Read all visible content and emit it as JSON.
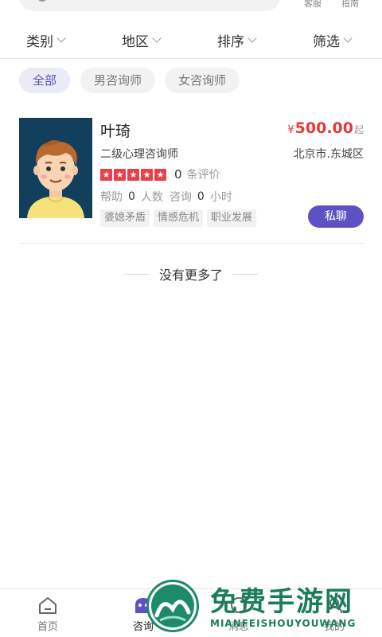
{
  "top": {
    "kefu_label": "客服",
    "guide_label": "指南"
  },
  "filters": [
    {
      "label": "类别"
    },
    {
      "label": "地区"
    },
    {
      "label": "排序"
    },
    {
      "label": "筛选"
    }
  ],
  "chips": [
    {
      "label": "全部",
      "active": true
    },
    {
      "label": "男咨询师",
      "active": false
    },
    {
      "label": "女咨询师",
      "active": false
    }
  ],
  "counselor": {
    "name": "叶琦",
    "currency": "¥",
    "price": "500.00",
    "price_suffix": "起",
    "title": "二级心理咨询师",
    "location": "北京市.东城区",
    "rating_stars": 5,
    "review_count": "0",
    "review_label": "条评价",
    "help_label": "帮助",
    "help_count": "0",
    "help_unit": "人数",
    "consult_label": "咨询",
    "consult_count": "0",
    "consult_unit": "小时",
    "tags": [
      "婆媳矛盾",
      "情感危机",
      "职业发展"
    ],
    "chat_label": "私聊"
  },
  "list_end_text": "没有更多了",
  "tabs": [
    {
      "label": "首页",
      "icon": "home-icon",
      "active": false
    },
    {
      "label": "咨询",
      "icon": "consult-icon",
      "active": true
    },
    {
      "label": "消息",
      "icon": "message-icon",
      "active": false
    },
    {
      "label": "我的",
      "icon": "profile-icon",
      "active": false
    }
  ],
  "watermark": {
    "main": "免费手游网",
    "sub": "MIANFEISHOUYOUWANG"
  },
  "colors": {
    "accent": "#5d51c4",
    "price": "#e13b3b",
    "star": "#e8404a",
    "watermark": "#1b7d5c"
  }
}
